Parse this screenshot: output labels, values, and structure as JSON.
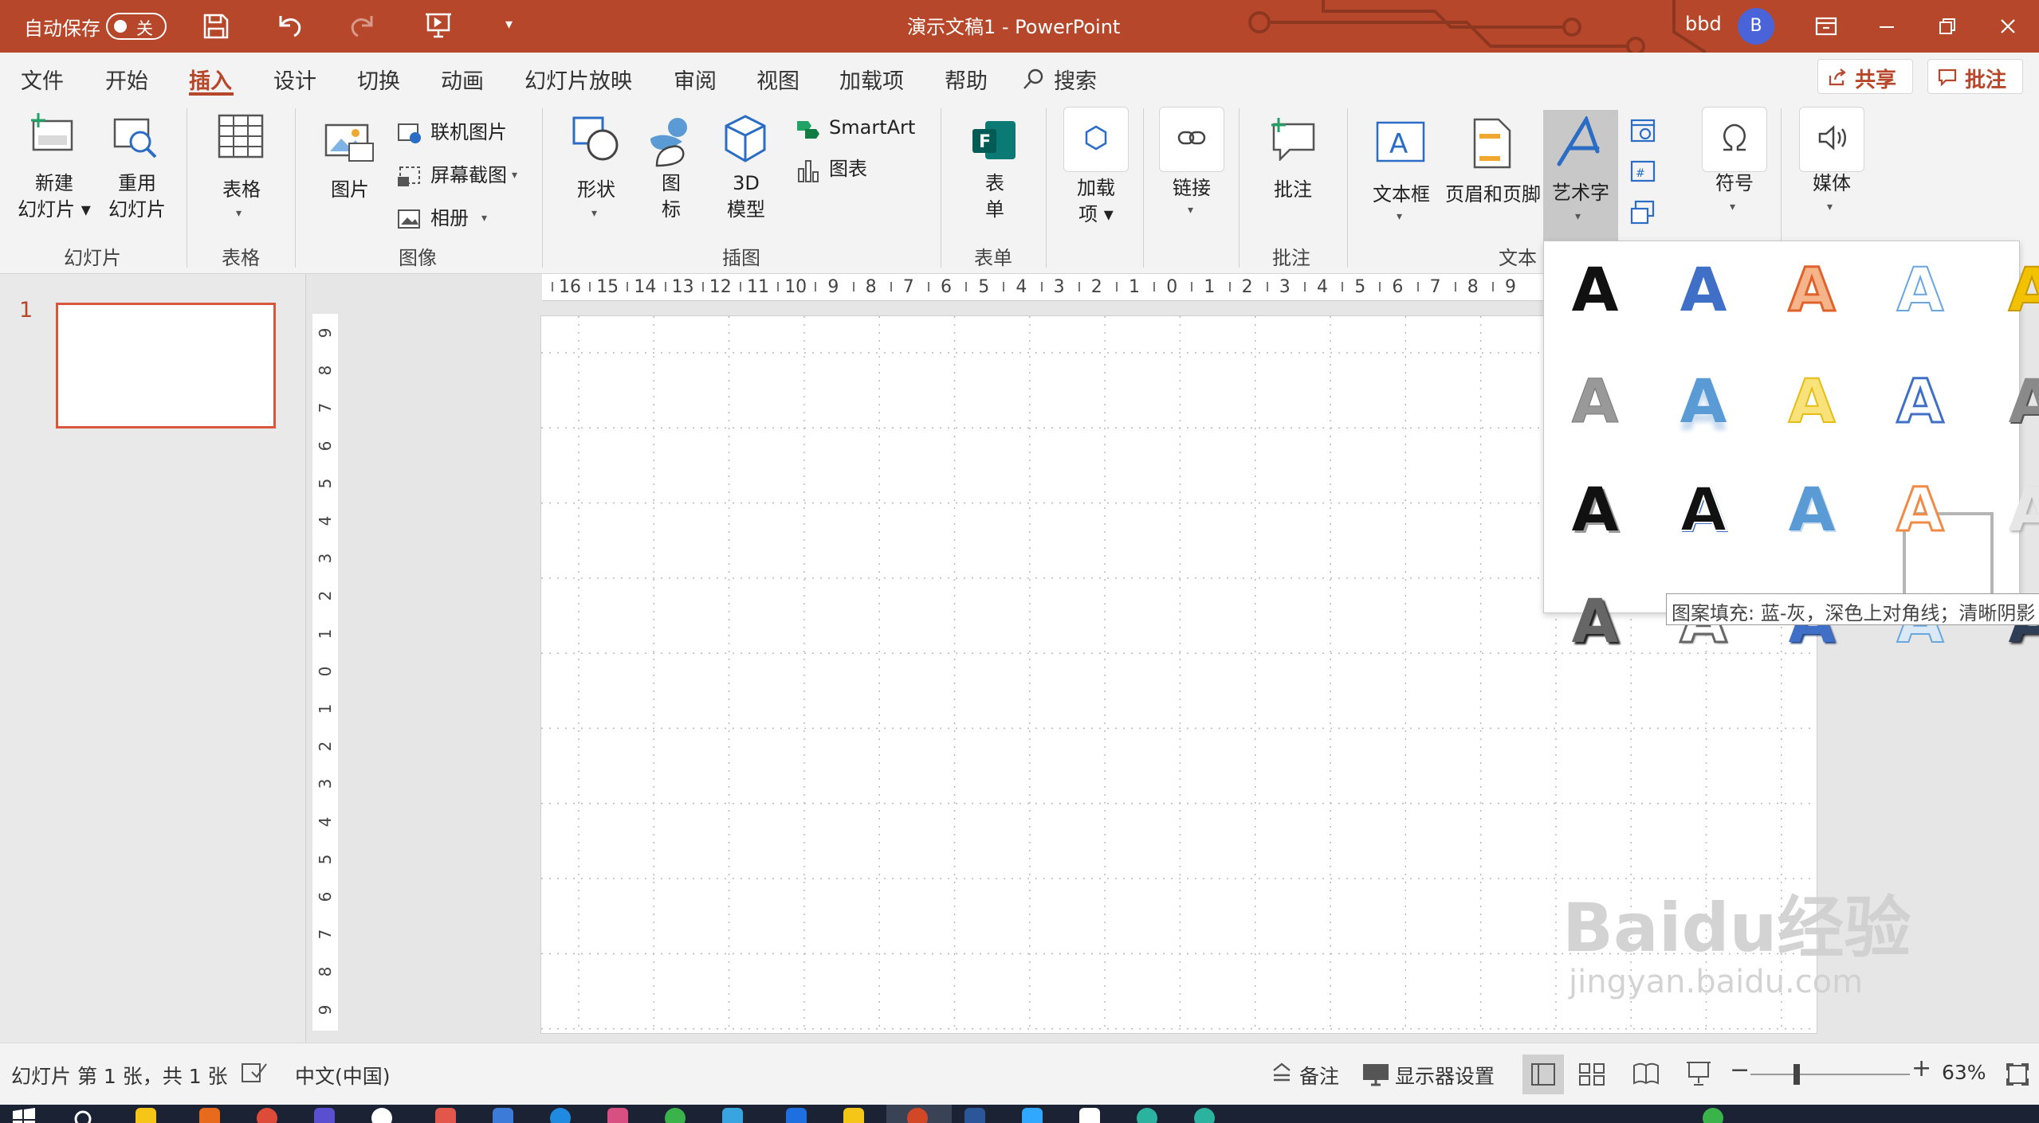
{
  "titlebar": {
    "autosave_label": "自动保存",
    "autosave_state": "关",
    "document_title": "演示文稿1  -  PowerPoint",
    "user_name": "bbd",
    "avatar_letter": "B",
    "accent_color": "#b7472a"
  },
  "menu": {
    "items": [
      "文件",
      "开始",
      "插入",
      "设计",
      "切换",
      "动画",
      "幻灯片放映",
      "审阅",
      "视图",
      "加载项",
      "帮助"
    ],
    "active": "插入",
    "search": "搜索",
    "share": "共享",
    "comments": "批注"
  },
  "ribbon": {
    "new_slide": [
      "新建",
      "幻灯片"
    ],
    "reuse_slide": [
      "重用",
      "幻灯片"
    ],
    "table": "表格",
    "picture": "图片",
    "online_picture": "联机图片",
    "screenshot": "屏幕截图",
    "album": "相册",
    "shapes": "形状",
    "icons": [
      "图",
      "标"
    ],
    "model3d": [
      "3D",
      "模型"
    ],
    "smartart": "SmartArt",
    "chart": "图表",
    "forms": [
      "表",
      "单"
    ],
    "addins": [
      "加载",
      "项"
    ],
    "link": "链接",
    "comment": "批注",
    "textbox": "文本框",
    "header_footer": "页眉和页脚",
    "wordart": "艺术字",
    "symbols": "符号",
    "media": "媒体",
    "groups": [
      "幻灯片",
      "表格",
      "图像",
      "插图",
      "表单",
      "批注",
      "文本"
    ]
  },
  "thumbnail": {
    "number": "1"
  },
  "rulers": {
    "horizontal": [
      "16",
      "15",
      "14",
      "13",
      "12",
      "11",
      "10",
      "9",
      "8",
      "7",
      "6",
      "5",
      "4",
      "3",
      "2",
      "1",
      "0",
      "1",
      "2",
      "3",
      "4",
      "5",
      "6",
      "7",
      "8",
      "9"
    ],
    "vertical": [
      "9",
      "8",
      "7",
      "6",
      "5",
      "4",
      "3",
      "2",
      "1",
      "0",
      "1",
      "2",
      "3",
      "4",
      "5",
      "6",
      "7",
      "8",
      "9"
    ]
  },
  "wordart_gallery": {
    "glyph": "A",
    "tooltip": "图案填充: 蓝-灰，深色上对角线；清晰阴影"
  },
  "status": {
    "slide_info": "幻灯片 第 1 张，共 1 张",
    "language": "中文(中国)",
    "notes": "备注",
    "display_settings": "显示器设置",
    "zoom": "63%"
  },
  "watermark": {
    "line1": "Baidu经验",
    "line2": "jingyan.baidu.com"
  }
}
